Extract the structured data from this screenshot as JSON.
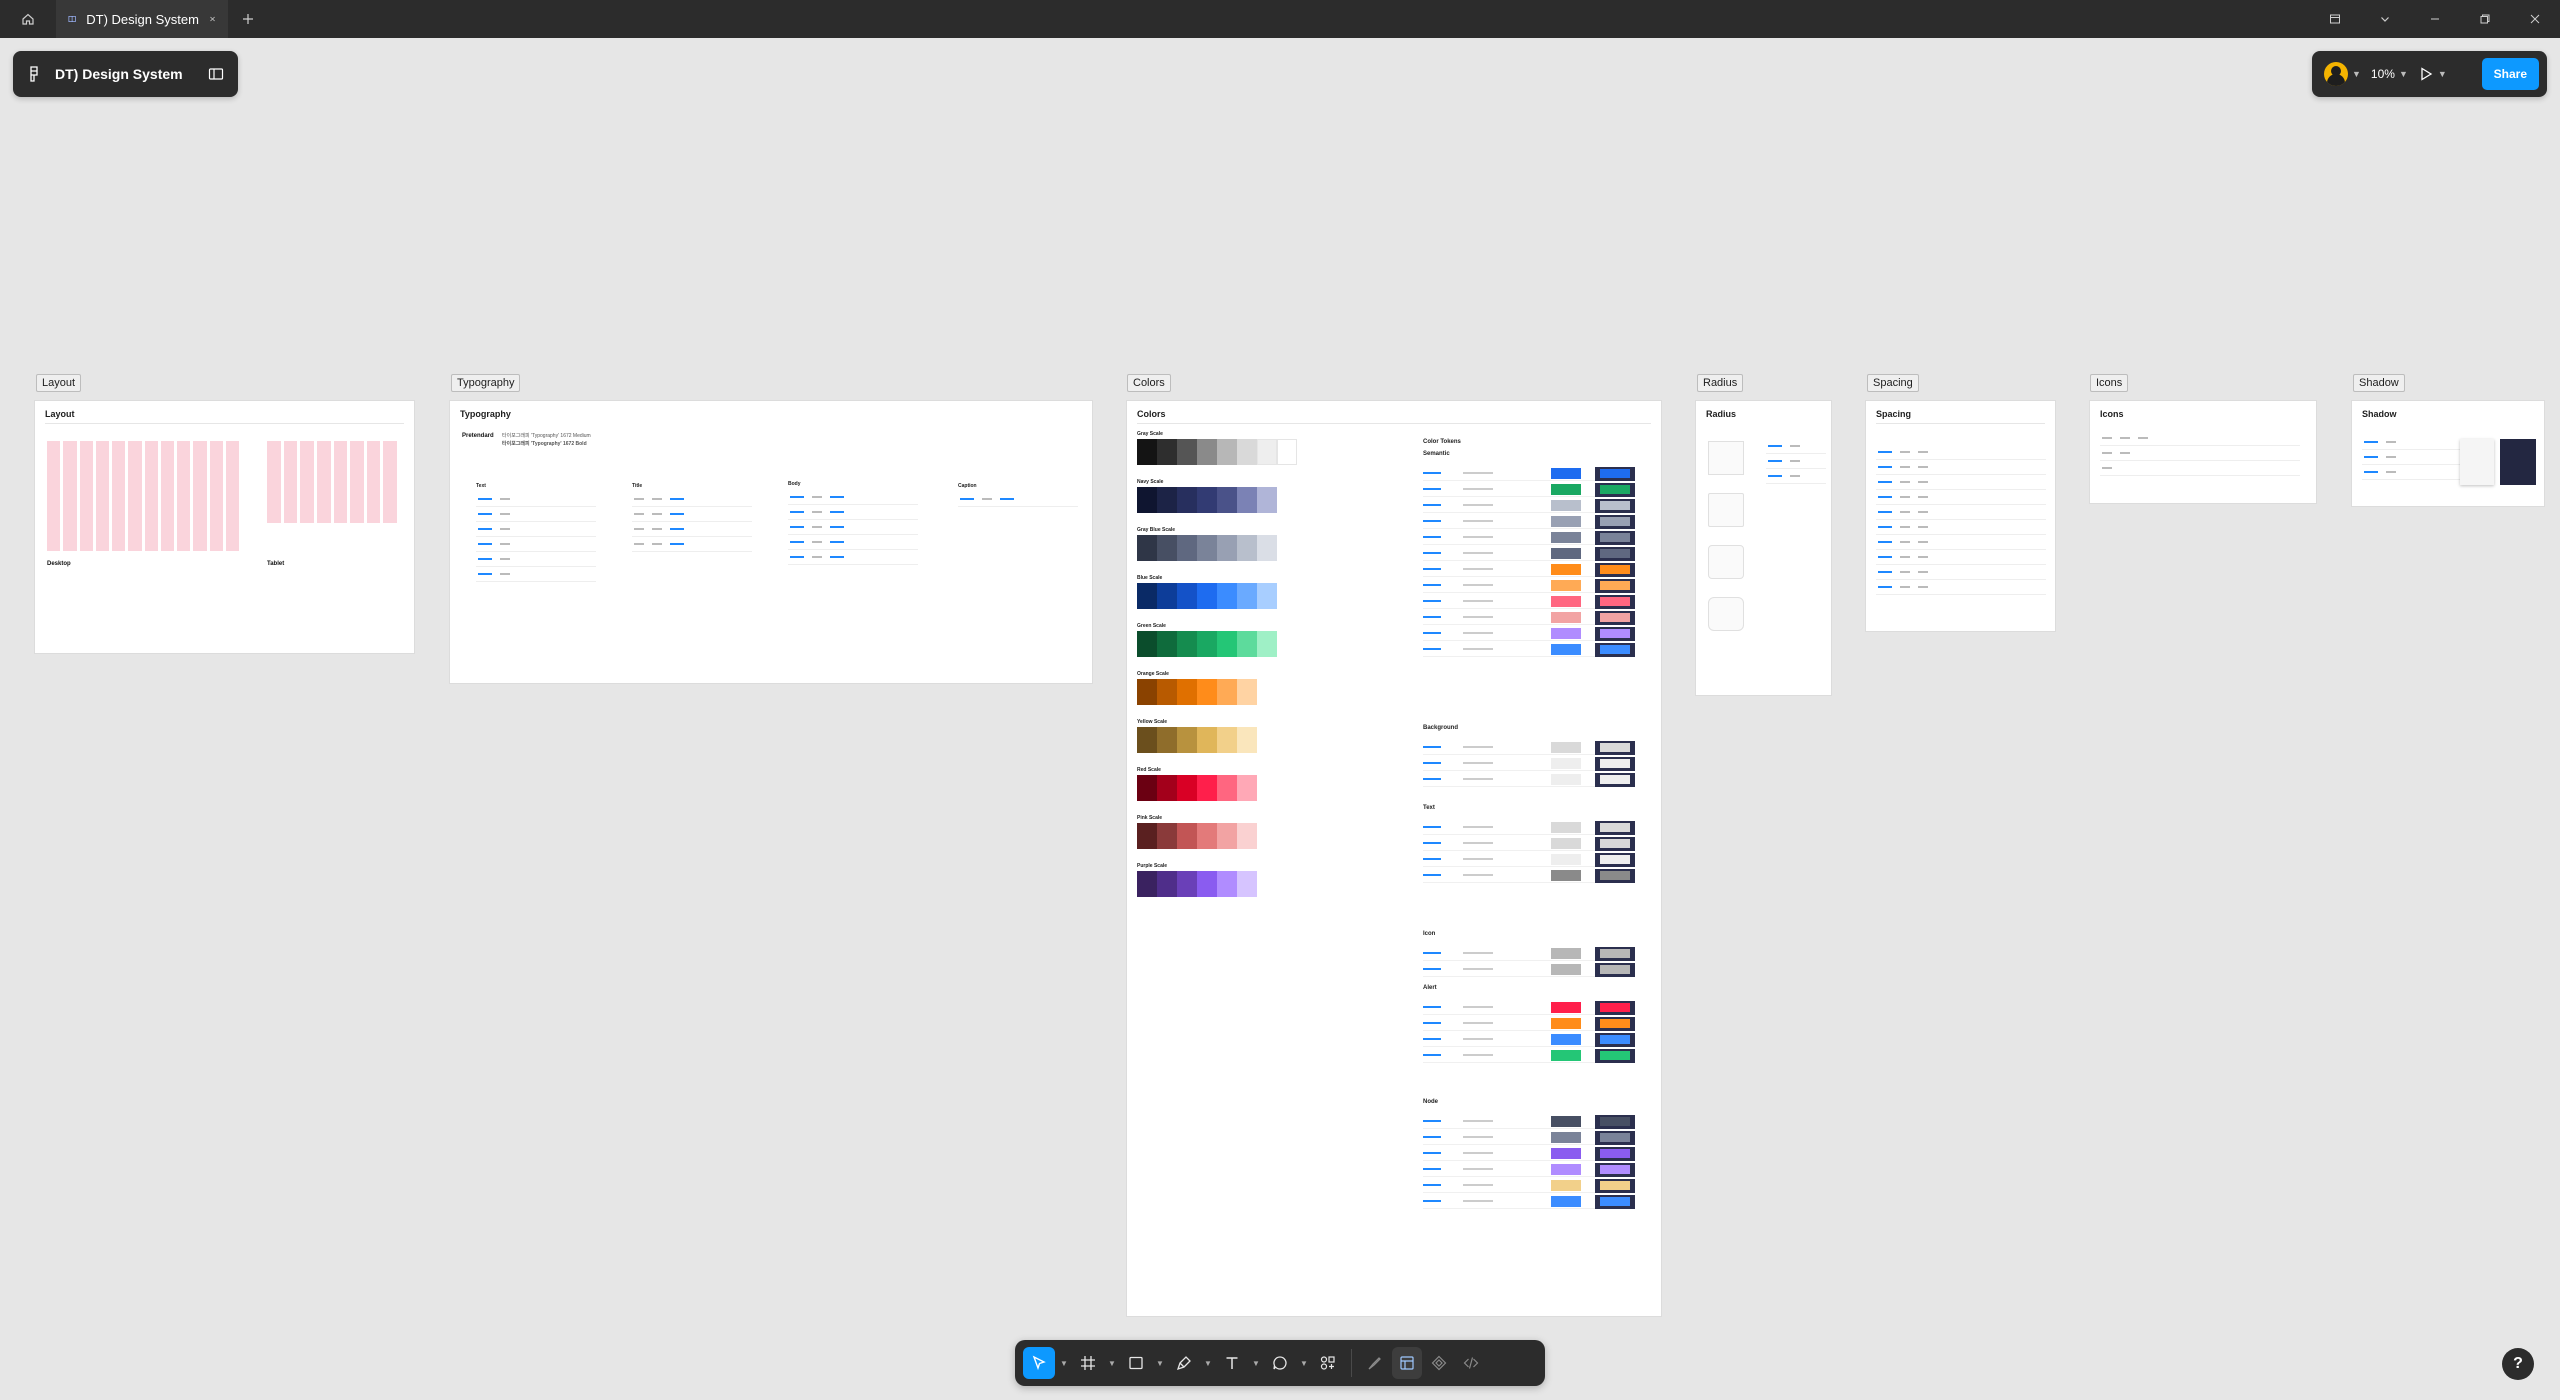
{
  "titlebar": {
    "tab_title": "DT) Design System"
  },
  "file_panel": {
    "file_name": "DT) Design System"
  },
  "right_panel": {
    "zoom": "10%",
    "share_label": "Share"
  },
  "frames": {
    "layout": {
      "label": "Layout",
      "title": "Layout",
      "desktop": "Desktop",
      "tablet": "Tablet"
    },
    "typography": {
      "label": "Typography",
      "title": "Typography",
      "font_name": "Pretendard",
      "font_line_1": "타이포그래피 'Typography' 1672 Medium",
      "font_line_2": "타이포그래피 'Typography' 1672 Bold",
      "col_text": "Text",
      "col_title": "Title",
      "col_body": "Body",
      "col_caption": "Caption"
    },
    "colors": {
      "label": "Colors",
      "title": "Colors",
      "scales": [
        "Gray Scale",
        "Navy Scale",
        "Gray Blue Scale",
        "Blue Scale",
        "Green Scale",
        "Orange Scale",
        "Yellow Scale",
        "Red Scale",
        "Pink Scale",
        "Purple Scale"
      ],
      "token_title": "Color Tokens",
      "token_sections": [
        "Semantic",
        "Background",
        "Text",
        "Icon",
        "Alert",
        "Node"
      ]
    },
    "radius": {
      "label": "Radius",
      "title": "Radius"
    },
    "spacing": {
      "label": "Spacing",
      "title": "Spacing"
    },
    "icons": {
      "label": "Icons",
      "title": "Icons"
    },
    "shadow": {
      "label": "Shadow",
      "title": "Shadow"
    }
  },
  "palette": {
    "gray": [
      "#141414",
      "#2e2e2e",
      "#555555",
      "#8a8a8a",
      "#b7b7b7",
      "#d9d9d9",
      "#eeeeee",
      "#ffffff"
    ],
    "navy": [
      "#0f1530",
      "#1c2346",
      "#272f5e",
      "#323b73",
      "#4a5289",
      "#7b82b5",
      "#b0b5d8"
    ],
    "grayblue": [
      "#2f3647",
      "#474f63",
      "#5f6880",
      "#7a8399",
      "#98a0b3",
      "#b8bfcc",
      "#dadee6"
    ],
    "blue": [
      "#0a2a66",
      "#0d3d99",
      "#1452c8",
      "#1e6cf0",
      "#3b8cff",
      "#6aaaff",
      "#a8ceff"
    ],
    "green": [
      "#0b4d2c",
      "#0f6b3c",
      "#158c4f",
      "#1aa862",
      "#24c676",
      "#5ddb9c",
      "#9ff0c6"
    ],
    "orange": [
      "#8a4200",
      "#b85a00",
      "#e07000",
      "#ff8c1a",
      "#ffaa55",
      "#ffd3a3"
    ],
    "yellow": [
      "#6b4f1d",
      "#8f6d2b",
      "#b8923e",
      "#e0b65a",
      "#f2d08a",
      "#fae6bc"
    ],
    "red": [
      "#6b0012",
      "#a3001b",
      "#d90025",
      "#ff1f4b",
      "#ff6680",
      "#ffa8b6"
    ],
    "pink": [
      "#5a2020",
      "#8a3a3a",
      "#c25555",
      "#e37a7a",
      "#f2a3a3",
      "#fad1d1"
    ],
    "purple": [
      "#3a2260",
      "#4f2e8a",
      "#6a40b8",
      "#8a5cf0",
      "#b08cff",
      "#d6c4ff"
    ]
  }
}
